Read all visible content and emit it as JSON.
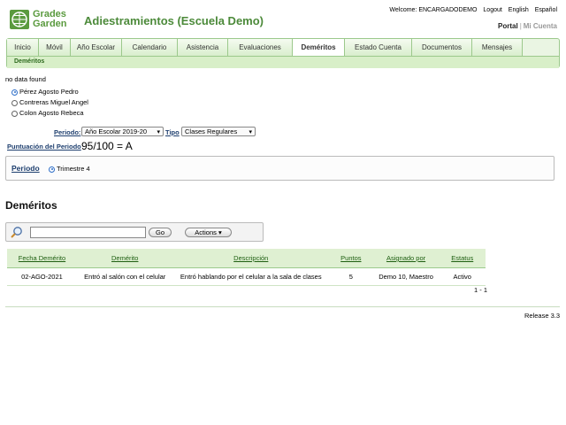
{
  "header": {
    "logo_line1": "Grades",
    "logo_line2": "Garden",
    "title": "Adiestramientos (Escuela Demo)",
    "welcome": "Welcome: ENCARGADODEMO",
    "logout": "Logout",
    "english": "English",
    "espanol": "Español",
    "portal": "Portal",
    "separator": "|",
    "mi_cuenta": "Mi Cuenta"
  },
  "nav": {
    "tabs": [
      "Inicio",
      "Móvil",
      "Año Escolar",
      "Calendario",
      "Asistencia",
      "Evaluaciones",
      "Deméritos",
      "Estado Cuenta",
      "Documentos",
      "Mensajes"
    ],
    "active": "Deméritos",
    "subnav": "Deméritos"
  },
  "no_data": "no data found",
  "students": [
    "Pérez Agosto Pedro",
    "Contreras Miguel Angel",
    "Colon Agosto Rebeca"
  ],
  "filters": {
    "periodo_label": "Periodo:",
    "periodo_value": "Año Escolar 2019-20",
    "tipo_label": "Tipo",
    "tipo_value": "Clases Regulares"
  },
  "score": {
    "label": "Puntuación del Periodo",
    "value": "95/100 = A"
  },
  "periodo_box": {
    "label": "Periodo",
    "option": "Trimestre 4"
  },
  "section_title": "Deméritos",
  "toolbar": {
    "search_value": "",
    "go": "Go",
    "actions": "Actions"
  },
  "table": {
    "headers": [
      "Fecha Demérito",
      "Demérito",
      "Descripción",
      "Puntos",
      "Asignado por",
      "Estatus"
    ],
    "rows": [
      [
        "02-AGO-2021",
        "Entró al salón con el celular",
        "Entró hablando por el celular a la sala de clases",
        "5",
        "Demo 10, Maestro",
        "Activo"
      ]
    ],
    "pagination": "1 - 1"
  },
  "footer": {
    "release": "Release 3.3"
  },
  "colors": {
    "brand_green": "#4c8a3a",
    "nav_border": "#9cc98c",
    "table_header": "#dff0d2",
    "radio_blue": "#2f6fc8"
  }
}
